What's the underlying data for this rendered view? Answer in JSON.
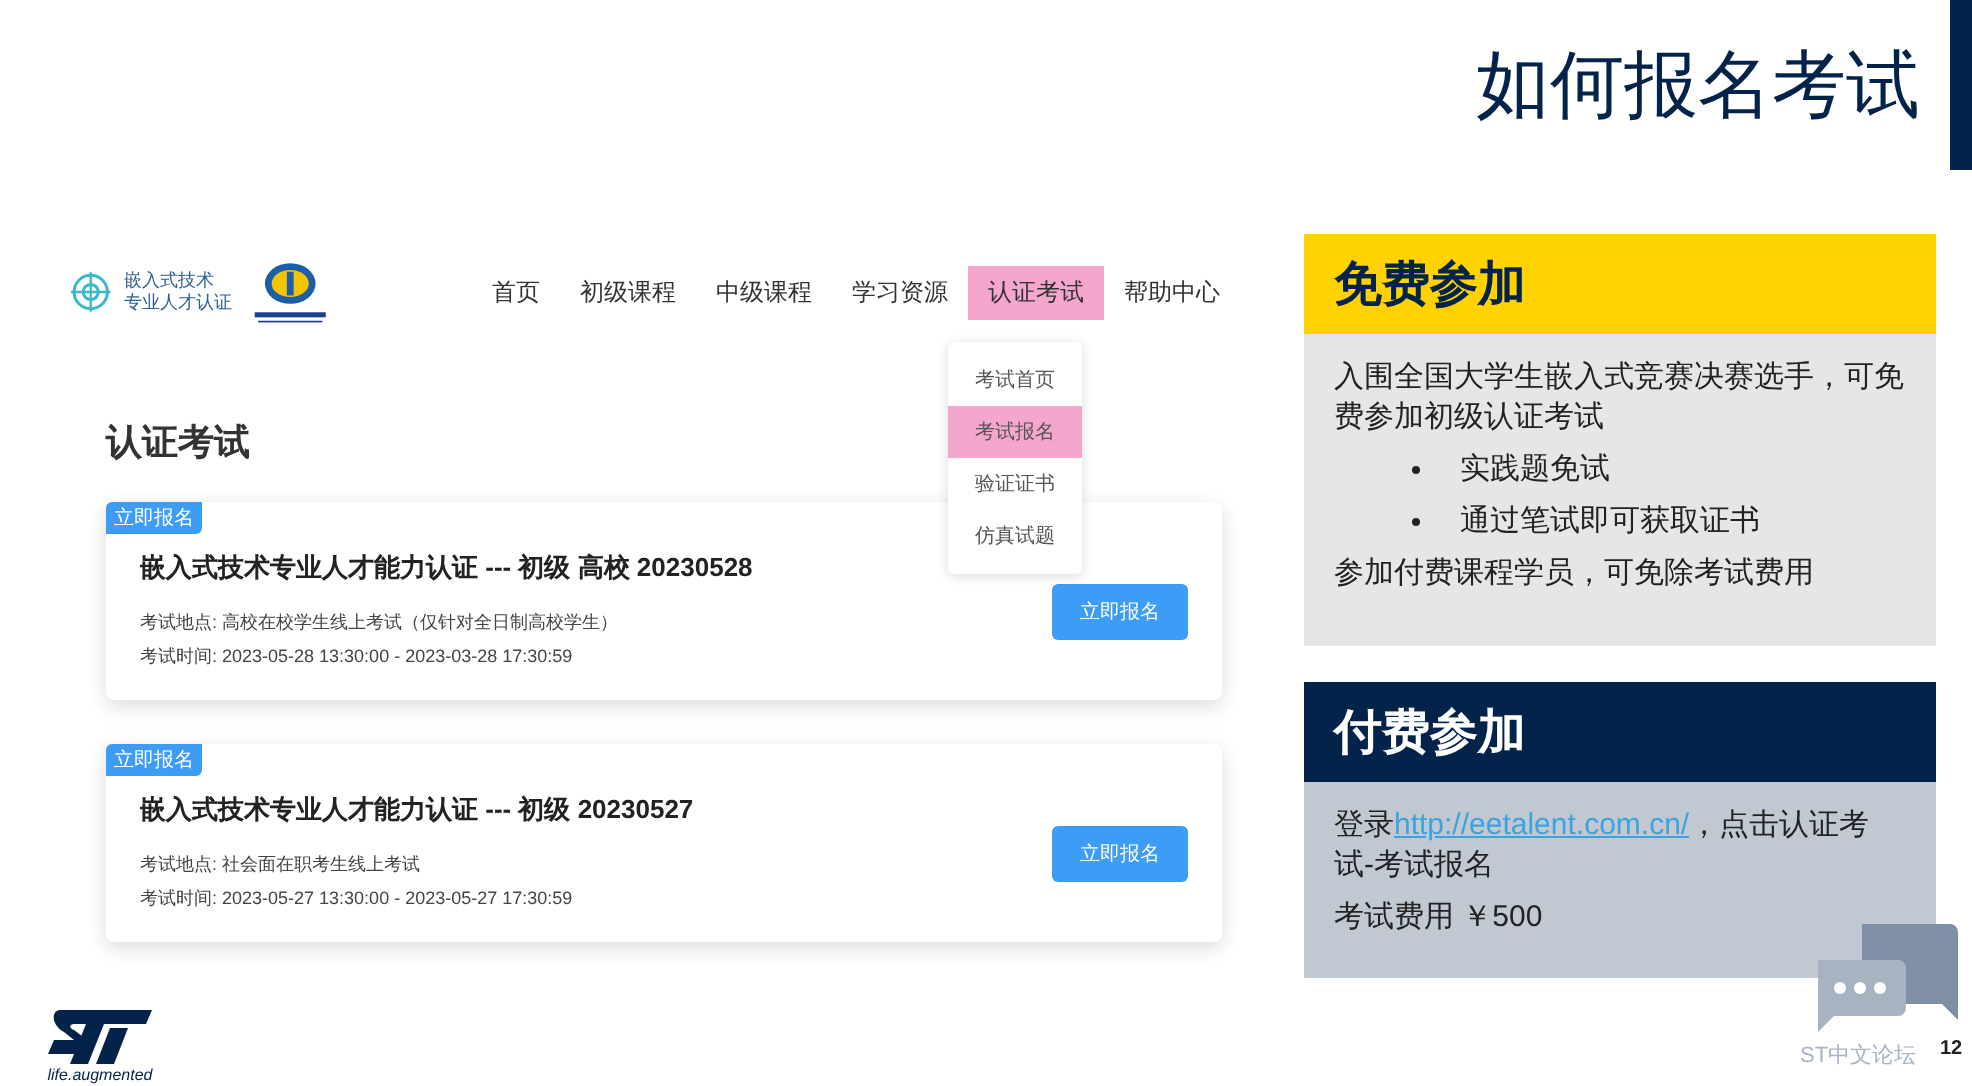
{
  "slide": {
    "title": "如何报名考试",
    "page_number": "12"
  },
  "site": {
    "logo_text": [
      "嵌入式技术",
      "专业人才认证"
    ],
    "nav": [
      {
        "label": "首页",
        "selected": false
      },
      {
        "label": "初级课程",
        "selected": false
      },
      {
        "label": "中级课程",
        "selected": false
      },
      {
        "label": "学习资源",
        "selected": false
      },
      {
        "label": "认证考试",
        "selected": true
      },
      {
        "label": "帮助中心",
        "selected": false
      }
    ],
    "dropdown": [
      {
        "label": "考试首页",
        "selected": false
      },
      {
        "label": "考试报名",
        "selected": true
      },
      {
        "label": "验证证书",
        "selected": false
      },
      {
        "label": "仿真试题",
        "selected": false
      }
    ],
    "heading": "认证考试",
    "exams": [
      {
        "badge": "立即报名",
        "title": "嵌入式技术专业人才能力认证 --- 初级 高校 20230528",
        "location": "考试地点: 高校在校学生线上考试（仅针对全日制高校学生）",
        "time": "考试时间: 2023-05-28 13:30:00 - 2023-03-28 17:30:59",
        "button": "立即报名"
      },
      {
        "badge": "立即报名",
        "title": "嵌入式技术专业人才能力认证 --- 初级 20230527",
        "location": "考试地点: 社会面在职考生线上考试",
        "time": "考试时间: 2023-05-27 13:30:00 - 2023-05-27 17:30:59",
        "button": "立即报名"
      }
    ]
  },
  "panels": [
    {
      "kind": "free",
      "title": "免费参加",
      "lines": [
        {
          "kind": "text",
          "text": "入围全国大学生嵌入式竞赛决赛选手，可免费参加初级认证考试"
        },
        {
          "kind": "bullet",
          "text": "实践题免试"
        },
        {
          "kind": "bullet",
          "text": "通过笔试即可获取证书"
        },
        {
          "kind": "text",
          "text": "参加付费课程学员，可免除考试费用"
        }
      ]
    },
    {
      "kind": "paid",
      "title": "付费参加",
      "lines": [
        {
          "kind": "link_text",
          "before": "登录",
          "link": "http://eetalent.com.cn/",
          "after": "，点击认证考试-考试报名"
        },
        {
          "kind": "text",
          "text": "考试费用 ￥500"
        }
      ]
    }
  ],
  "footer": {
    "brand_tagline": "life.augmented",
    "forum_label": "ST中文论坛"
  }
}
